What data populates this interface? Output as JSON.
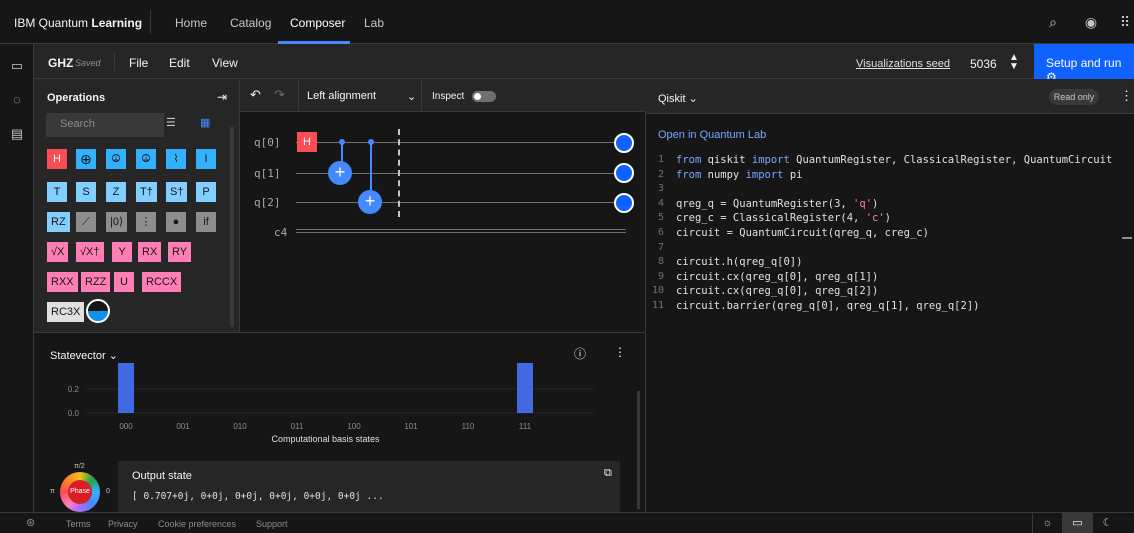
{
  "nav": {
    "brand_light": "IBM Quantum ",
    "brand_bold": "Learning",
    "items": [
      "Home",
      "Catalog",
      "Composer",
      "Lab"
    ],
    "active": "Composer",
    "icons": [
      "search-icon",
      "user-avatar-icon",
      "app-switcher-icon"
    ]
  },
  "rail": {
    "icons": [
      "folder-icon",
      "dashboard-icon",
      "docs-icon"
    ]
  },
  "toolbar": {
    "file_name": "GHZ",
    "saved": "Saved",
    "menus": [
      "File",
      "Edit",
      "View"
    ],
    "vis_seed_label": "Visualizations seed",
    "vis_seed_value": "5036",
    "setup_label": "Setup and run"
  },
  "operations": {
    "title": "Operations",
    "search_placeholder": "Search",
    "gates": [
      [
        "H",
        "⊕",
        "⦹",
        "⦹",
        "⌇",
        "I"
      ],
      [
        "T",
        "S",
        "Z",
        "T†",
        "S†",
        "P"
      ],
      [
        "RZ",
        "⟋",
        "|0⟩",
        "⋮",
        "●",
        "if"
      ],
      [
        "√X",
        "√X†",
        "Y",
        "RX",
        "RY"
      ],
      [
        "RXX",
        "RZZ",
        "U",
        "RCCX"
      ],
      [
        "RC3X",
        "◐"
      ]
    ]
  },
  "circuit": {
    "undo": "↶",
    "redo": "↷",
    "alignment": "Left alignment",
    "inspect_label": "Inspect",
    "inspect_on": false,
    "qubits": [
      "q[0]",
      "q[1]",
      "q[2]"
    ],
    "classical": "c4",
    "h_gate": "H"
  },
  "code": {
    "language": "Qiskit",
    "read_only": "Read only",
    "open_lab": "Open in Quantum Lab",
    "lines": [
      "from qiskit import QuantumRegister, ClassicalRegister, QuantumCircuit",
      "from numpy import pi",
      "",
      "qreg_q = QuantumRegister(3, 'q')",
      "creg_c = ClassicalRegister(4, 'c')",
      "circuit = QuantumCircuit(qreg_q, creg_c)",
      "",
      "circuit.h(qreg_q[0])",
      "circuit.cx(qreg_q[0], qreg_q[1])",
      "circuit.cx(qreg_q[0], qreg_q[2])",
      "circuit.barrier(qreg_q[0], qreg_q[1], qreg_q[2])"
    ]
  },
  "statevector": {
    "title": "Statevector",
    "output_title": "Output state",
    "output_value": "[ 0.707+0j, 0+0j, 0+0j, 0+0j, 0+0j, 0+0j ...",
    "phase_label": "Phase",
    "phase_top": "π/2",
    "phase_left": "π",
    "phase_right": "0"
  },
  "chart_data": {
    "type": "bar",
    "categories": [
      "000",
      "001",
      "010",
      "011",
      "100",
      "101",
      "110",
      "111"
    ],
    "values": [
      0.5,
      0,
      0,
      0,
      0,
      0,
      0,
      0.5
    ],
    "yticks": [
      "0.2",
      "0.0"
    ],
    "xlabel": "Computational basis states",
    "color": "#4169e1"
  },
  "footer": {
    "links": [
      "Terms",
      "Privacy",
      "Cookie preferences",
      "Support"
    ]
  },
  "colors": {
    "accent": "#0f62fe",
    "h_gate": "#fa4d56",
    "cx": "#33b1ff"
  }
}
